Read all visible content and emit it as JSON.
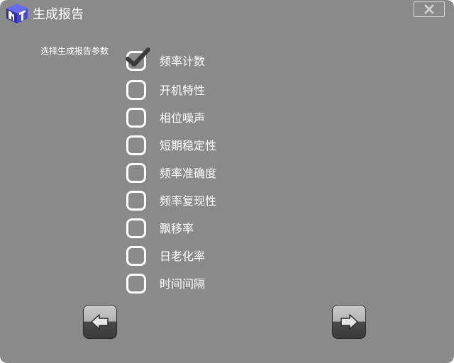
{
  "window": {
    "title": "生成报告",
    "logo_icon": "cube-logo-icon",
    "close_icon": "close-x-icon"
  },
  "params": {
    "label": "选择生成报告参数",
    "options": [
      {
        "label": "频率计数",
        "checked": true
      },
      {
        "label": "开机特性",
        "checked": false
      },
      {
        "label": "相位噪声",
        "checked": false
      },
      {
        "label": "短期稳定性",
        "checked": false
      },
      {
        "label": "频率准确度",
        "checked": false
      },
      {
        "label": "频率复现性",
        "checked": false
      },
      {
        "label": "飘移率",
        "checked": false
      },
      {
        "label": "日老化率",
        "checked": false
      },
      {
        "label": "时间间隔",
        "checked": false
      }
    ]
  },
  "nav": {
    "back_icon": "arrow-left-icon",
    "next_icon": "arrow-right-icon"
  },
  "colors": {
    "background": "#8a8a8a",
    "text": "#ffffff",
    "checkmark": "#3a3a3a",
    "logo_blue": "#3a3ad6"
  }
}
